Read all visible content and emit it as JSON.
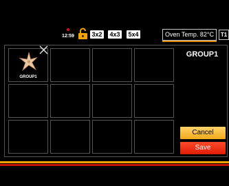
{
  "status": {
    "clock": "12:59",
    "layouts": [
      "3x2",
      "4x3",
      "5x4"
    ],
    "oven_temp": "Oven Temp. 82°C",
    "tray": "T1"
  },
  "grid": {
    "cells": [
      {
        "label": "GROUP1",
        "icon": "starfish-icon"
      },
      {
        "label": ""
      },
      {
        "label": ""
      },
      {
        "label": ""
      },
      {
        "label": ""
      },
      {
        "label": ""
      },
      {
        "label": ""
      },
      {
        "label": ""
      },
      {
        "label": ""
      },
      {
        "label": ""
      },
      {
        "label": ""
      },
      {
        "label": ""
      }
    ]
  },
  "panel": {
    "title": "GROUP1",
    "cancel_label": "Cancel",
    "save_label": "Save"
  },
  "colors": {
    "cancel": "#f2a91a",
    "save": "#e01d06",
    "accent_yellow": "#f5a300",
    "accent_red": "#c8140a"
  }
}
